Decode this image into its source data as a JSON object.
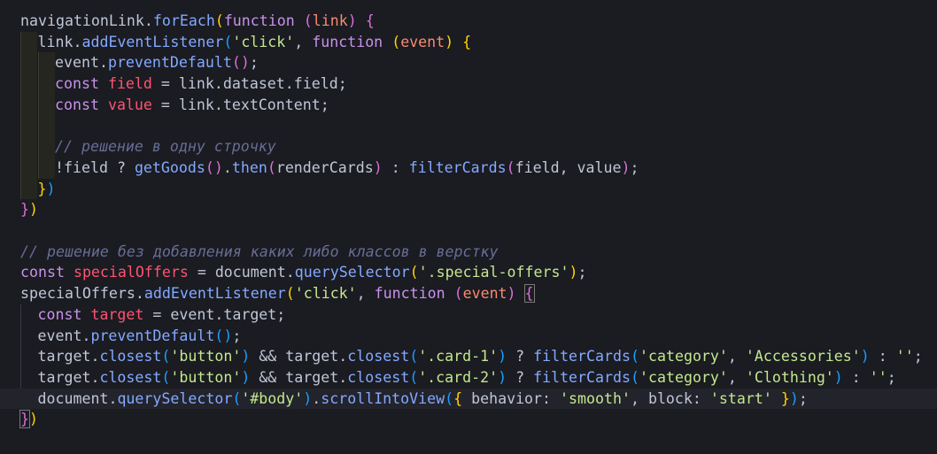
{
  "code": {
    "lines": [
      {
        "indent": 0,
        "tokens": [
          {
            "t": "navigationLink",
            "c": "pn"
          },
          {
            "t": ".",
            "c": "pn"
          },
          {
            "t": "forEach",
            "c": "fn"
          },
          {
            "t": "(",
            "c": "b1"
          },
          {
            "t": "function",
            "c": "kw"
          },
          {
            "t": " ",
            "c": "pn"
          },
          {
            "t": "(",
            "c": "b2"
          },
          {
            "t": "link",
            "c": "pr"
          },
          {
            "t": ")",
            "c": "b2"
          },
          {
            "t": " ",
            "c": "pn"
          },
          {
            "t": "{",
            "c": "b2"
          }
        ]
      },
      {
        "indent": 1,
        "tokens": [
          {
            "t": "link",
            "c": "pn"
          },
          {
            "t": ".",
            "c": "pn"
          },
          {
            "t": "addEventListener",
            "c": "fn"
          },
          {
            "t": "(",
            "c": "b3"
          },
          {
            "t": "'click'",
            "c": "st"
          },
          {
            "t": ", ",
            "c": "pn"
          },
          {
            "t": "function",
            "c": "kw"
          },
          {
            "t": " ",
            "c": "pn"
          },
          {
            "t": "(",
            "c": "b1"
          },
          {
            "t": "event",
            "c": "pr"
          },
          {
            "t": ")",
            "c": "b1"
          },
          {
            "t": " ",
            "c": "pn"
          },
          {
            "t": "{",
            "c": "b1"
          }
        ]
      },
      {
        "indent": 2,
        "tokens": [
          {
            "t": "event",
            "c": "pn"
          },
          {
            "t": ".",
            "c": "pn"
          },
          {
            "t": "preventDefault",
            "c": "fn"
          },
          {
            "t": "()",
            "c": "b2"
          },
          {
            "t": ";",
            "c": "pn"
          }
        ]
      },
      {
        "indent": 2,
        "tokens": [
          {
            "t": "const",
            "c": "kw"
          },
          {
            "t": " ",
            "c": "pn"
          },
          {
            "t": "field",
            "c": "vr"
          },
          {
            "t": " = ",
            "c": "pn"
          },
          {
            "t": "link",
            "c": "pn"
          },
          {
            "t": ".",
            "c": "pn"
          },
          {
            "t": "dataset",
            "c": "pn"
          },
          {
            "t": ".",
            "c": "pn"
          },
          {
            "t": "field",
            "c": "pn"
          },
          {
            "t": ";",
            "c": "pn"
          }
        ]
      },
      {
        "indent": 2,
        "tokens": [
          {
            "t": "const",
            "c": "kw"
          },
          {
            "t": " ",
            "c": "pn"
          },
          {
            "t": "value",
            "c": "vr"
          },
          {
            "t": " = ",
            "c": "pn"
          },
          {
            "t": "link",
            "c": "pn"
          },
          {
            "t": ".",
            "c": "pn"
          },
          {
            "t": "textContent",
            "c": "pn"
          },
          {
            "t": ";",
            "c": "pn"
          }
        ]
      },
      {
        "indent": 2,
        "tokens": []
      },
      {
        "indent": 2,
        "tokens": [
          {
            "t": "// решение в одну строчку",
            "c": "cm"
          }
        ]
      },
      {
        "indent": 2,
        "tokens": [
          {
            "t": "!field",
            "c": "pn"
          },
          {
            "t": " ? ",
            "c": "pn"
          },
          {
            "t": "getGoods",
            "c": "fn"
          },
          {
            "t": "()",
            "c": "b2"
          },
          {
            "t": ".",
            "c": "pn"
          },
          {
            "t": "then",
            "c": "fn"
          },
          {
            "t": "(",
            "c": "b2"
          },
          {
            "t": "renderCards",
            "c": "pn"
          },
          {
            "t": ")",
            "c": "b2"
          },
          {
            "t": " : ",
            "c": "pn"
          },
          {
            "t": "filterCards",
            "c": "fn"
          },
          {
            "t": "(",
            "c": "b2"
          },
          {
            "t": "field, value",
            "c": "pn"
          },
          {
            "t": ")",
            "c": "b2"
          },
          {
            "t": ";",
            "c": "pn"
          }
        ]
      },
      {
        "indent": 1,
        "tokens": [
          {
            "t": "}",
            "c": "b1"
          },
          {
            "t": ")",
            "c": "b3"
          }
        ]
      },
      {
        "indent": 0,
        "tokens": [
          {
            "t": "}",
            "c": "b2"
          },
          {
            "t": ")",
            "c": "b1"
          }
        ]
      },
      {
        "indent": 0,
        "tokens": []
      },
      {
        "indent": 0,
        "tokens": [
          {
            "t": "// решение без добавления каких либо классов в верстку",
            "c": "cm"
          }
        ]
      },
      {
        "indent": 0,
        "tokens": [
          {
            "t": "const",
            "c": "kw"
          },
          {
            "t": " ",
            "c": "pn"
          },
          {
            "t": "specialOffers",
            "c": "vr"
          },
          {
            "t": " = ",
            "c": "pn"
          },
          {
            "t": "document",
            "c": "pn"
          },
          {
            "t": ".",
            "c": "pn"
          },
          {
            "t": "querySelector",
            "c": "fn"
          },
          {
            "t": "(",
            "c": "b1"
          },
          {
            "t": "'.special-offers'",
            "c": "st"
          },
          {
            "t": ")",
            "c": "b1"
          },
          {
            "t": ";",
            "c": "pn"
          }
        ]
      },
      {
        "indent": 0,
        "tokens": [
          {
            "t": "specialOffers",
            "c": "pn"
          },
          {
            "t": ".",
            "c": "pn"
          },
          {
            "t": "addEventListener",
            "c": "fn"
          },
          {
            "t": "(",
            "c": "b1"
          },
          {
            "t": "'click'",
            "c": "st"
          },
          {
            "t": ", ",
            "c": "pn"
          },
          {
            "t": "function",
            "c": "kw"
          },
          {
            "t": " ",
            "c": "pn"
          },
          {
            "t": "(",
            "c": "b2"
          },
          {
            "t": "event",
            "c": "pr"
          },
          {
            "t": ")",
            "c": "b2"
          },
          {
            "t": " ",
            "c": "pn"
          },
          {
            "t": "{",
            "c": "b2",
            "box": true
          }
        ]
      },
      {
        "indent": 1,
        "tokens": [
          {
            "t": "const",
            "c": "kw"
          },
          {
            "t": " ",
            "c": "pn"
          },
          {
            "t": "target",
            "c": "vr"
          },
          {
            "t": " = ",
            "c": "pn"
          },
          {
            "t": "event",
            "c": "pn"
          },
          {
            "t": ".",
            "c": "pn"
          },
          {
            "t": "target",
            "c": "pn"
          },
          {
            "t": ";",
            "c": "pn"
          }
        ]
      },
      {
        "indent": 1,
        "tokens": [
          {
            "t": "event",
            "c": "pn"
          },
          {
            "t": ".",
            "c": "pn"
          },
          {
            "t": "preventDefault",
            "c": "fn"
          },
          {
            "t": "()",
            "c": "b3"
          },
          {
            "t": ";",
            "c": "pn"
          }
        ]
      },
      {
        "indent": 1,
        "tokens": [
          {
            "t": "target",
            "c": "pn"
          },
          {
            "t": ".",
            "c": "pn"
          },
          {
            "t": "closest",
            "c": "fn"
          },
          {
            "t": "(",
            "c": "b3"
          },
          {
            "t": "'button'",
            "c": "st"
          },
          {
            "t": ")",
            "c": "b3"
          },
          {
            "t": " && ",
            "c": "pn"
          },
          {
            "t": "target",
            "c": "pn"
          },
          {
            "t": ".",
            "c": "pn"
          },
          {
            "t": "closest",
            "c": "fn"
          },
          {
            "t": "(",
            "c": "b3"
          },
          {
            "t": "'.card-1'",
            "c": "st"
          },
          {
            "t": ")",
            "c": "b3"
          },
          {
            "t": " ? ",
            "c": "pn"
          },
          {
            "t": "filterCards",
            "c": "fn"
          },
          {
            "t": "(",
            "c": "b3"
          },
          {
            "t": "'category'",
            "c": "st"
          },
          {
            "t": ", ",
            "c": "pn"
          },
          {
            "t": "'Accessories'",
            "c": "st"
          },
          {
            "t": ")",
            "c": "b3"
          },
          {
            "t": " : ",
            "c": "pn"
          },
          {
            "t": "''",
            "c": "st"
          },
          {
            "t": ";",
            "c": "pn"
          }
        ]
      },
      {
        "indent": 1,
        "tokens": [
          {
            "t": "target",
            "c": "pn"
          },
          {
            "t": ".",
            "c": "pn"
          },
          {
            "t": "closest",
            "c": "fn"
          },
          {
            "t": "(",
            "c": "b3"
          },
          {
            "t": "'button'",
            "c": "st"
          },
          {
            "t": ")",
            "c": "b3"
          },
          {
            "t": " && ",
            "c": "pn"
          },
          {
            "t": "target",
            "c": "pn"
          },
          {
            "t": ".",
            "c": "pn"
          },
          {
            "t": "closest",
            "c": "fn"
          },
          {
            "t": "(",
            "c": "b3"
          },
          {
            "t": "'.card-2'",
            "c": "st"
          },
          {
            "t": ")",
            "c": "b3"
          },
          {
            "t": " ? ",
            "c": "pn"
          },
          {
            "t": "filterCards",
            "c": "fn"
          },
          {
            "t": "(",
            "c": "b3"
          },
          {
            "t": "'category'",
            "c": "st"
          },
          {
            "t": ", ",
            "c": "pn"
          },
          {
            "t": "'Clothing'",
            "c": "st"
          },
          {
            "t": ")",
            "c": "b3"
          },
          {
            "t": " : ",
            "c": "pn"
          },
          {
            "t": "''",
            "c": "st"
          },
          {
            "t": ";",
            "c": "pn"
          }
        ]
      },
      {
        "indent": 1,
        "current": true,
        "tokens": [
          {
            "t": "document",
            "c": "pn"
          },
          {
            "t": ".",
            "c": "pn"
          },
          {
            "t": "querySelector",
            "c": "fn"
          },
          {
            "t": "(",
            "c": "b3"
          },
          {
            "t": "'#body'",
            "c": "st"
          },
          {
            "t": ")",
            "c": "b3"
          },
          {
            "t": ".",
            "c": "pn"
          },
          {
            "t": "scrollIntoView",
            "c": "fn"
          },
          {
            "t": "(",
            "c": "b3"
          },
          {
            "t": "{",
            "c": "b1"
          },
          {
            "t": " behavior: ",
            "c": "pn"
          },
          {
            "t": "'smooth'",
            "c": "st"
          },
          {
            "t": ", ",
            "c": "pn"
          },
          {
            "t": "block: ",
            "c": "pn"
          },
          {
            "t": "'start'",
            "c": "st"
          },
          {
            "t": " ",
            "c": "pn"
          },
          {
            "t": "}",
            "c": "b1"
          },
          {
            "t": ")",
            "c": "b3"
          },
          {
            "t": ";",
            "c": "pn"
          }
        ]
      },
      {
        "indent": 0,
        "tokens": [
          {
            "t": "}",
            "c": "b2",
            "box": true
          },
          {
            "t": ")",
            "c": "b1"
          }
        ]
      }
    ]
  }
}
